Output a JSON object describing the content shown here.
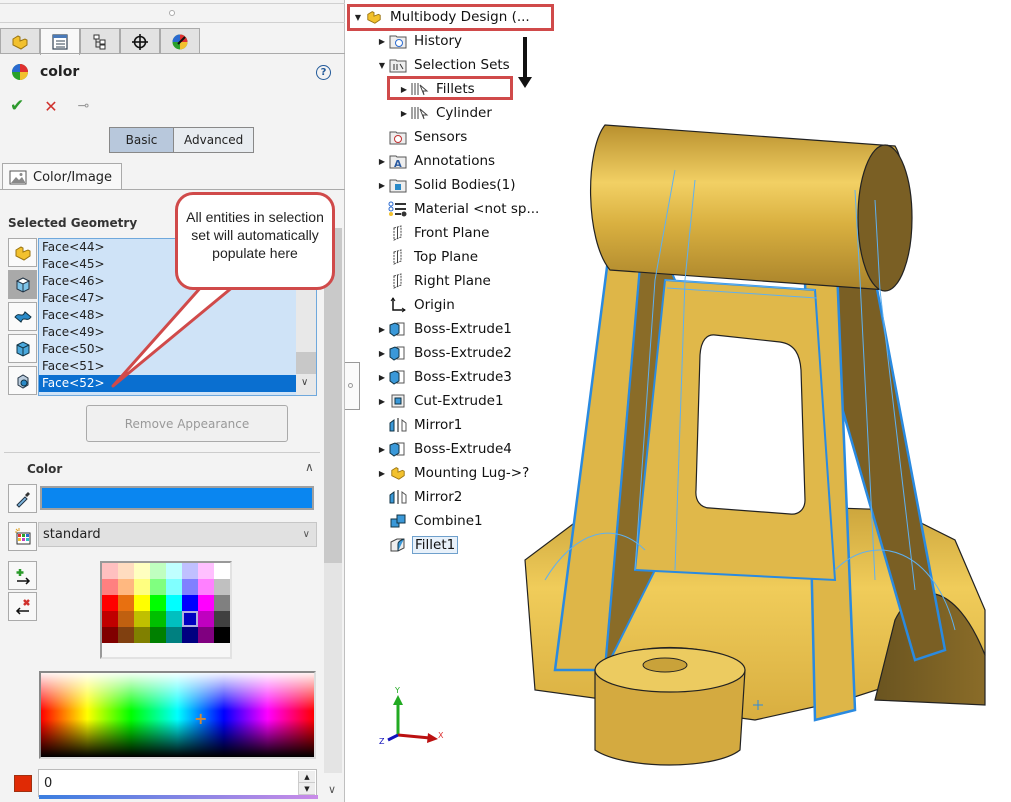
{
  "property_manager": {
    "manager_tabs": [
      {
        "icon": "feature-manager-icon",
        "active": false
      },
      {
        "icon": "property-manager-icon",
        "active": true
      },
      {
        "icon": "configuration-manager-icon",
        "active": false
      },
      {
        "icon": "dimxpert-manager-icon",
        "active": false
      },
      {
        "icon": "display-manager-icon",
        "active": false
      }
    ],
    "title": "color",
    "help_label": "?",
    "ok_label": "✔",
    "cancel_label": "✕",
    "pin_label": "⊸",
    "modes": {
      "basic": "Basic",
      "advanced": "Advanced",
      "active": "Basic"
    },
    "sub_tab": "Color/Image",
    "selected_geometry": {
      "heading": "Selected Geometry",
      "items": [
        "Face<44>",
        "Face<45>",
        "Face<46>",
        "Face<47>",
        "Face<48>",
        "Face<49>",
        "Face<50>",
        "Face<51>",
        "Face<52>"
      ],
      "selected": "Face<52>",
      "filters": [
        "part-filter-icon",
        "face-filter-icon",
        "surface-filter-icon",
        "body-filter-icon",
        "feature-filter-icon"
      ]
    },
    "remove_appearance_label": "Remove Appearance",
    "color_section": {
      "heading": "Color",
      "current_color": "#0a86f0",
      "palette_name": "standard",
      "palette": [
        [
          "#ffc0c0",
          "#ffdcc0",
          "#ffffc0",
          "#c0ffc0",
          "#c0ffff",
          "#c0c0ff",
          "#ffc0ff",
          "#ffffff"
        ],
        [
          "#ff8080",
          "#ffb880",
          "#ffff80",
          "#80ff80",
          "#80ffff",
          "#8080ff",
          "#ff80ff",
          "#c0c0c0"
        ],
        [
          "#ff0000",
          "#e87010",
          "#ffff00",
          "#00ff00",
          "#00ffff",
          "#0000ff",
          "#ff00ff",
          "#808080"
        ],
        [
          "#c00000",
          "#c06010",
          "#c0c000",
          "#00c000",
          "#00c0c0",
          "#0000c0",
          "#c000c0",
          "#404040"
        ],
        [
          "#800000",
          "#804010",
          "#808000",
          "#008000",
          "#008080",
          "#000080",
          "#800080",
          "#000000"
        ]
      ],
      "palette_selected": {
        "row": 3,
        "col": 5
      },
      "rgb_swatch": "#e02a05",
      "value_field": "0"
    }
  },
  "callout": {
    "text": "All entities in selection set will automatically populate here"
  },
  "feature_tree": {
    "items": [
      {
        "label": "Multibody Design  (...",
        "icon": "part-icon",
        "arrow": "expanded",
        "level": 0,
        "highlight": true
      },
      {
        "label": "History",
        "icon": "history-folder-icon",
        "arrow": "collapsed",
        "level": 1
      },
      {
        "label": "Selection Sets",
        "icon": "selection-sets-folder-icon",
        "arrow": "expanded",
        "level": 1
      },
      {
        "label": "Fillets",
        "icon": "selection-set-icon",
        "arrow": "collapsed",
        "level": 2,
        "highlight": true
      },
      {
        "label": "Cylinder",
        "icon": "selection-set-icon",
        "arrow": "collapsed",
        "level": 2
      },
      {
        "label": "Sensors",
        "icon": "sensors-folder-icon",
        "arrow": "none",
        "level": 1
      },
      {
        "label": "Annotations",
        "icon": "annotations-folder-icon",
        "arrow": "collapsed",
        "level": 1
      },
      {
        "label": "Solid Bodies(1)",
        "icon": "solid-bodies-folder-icon",
        "arrow": "collapsed",
        "level": 1
      },
      {
        "label": "Material <not sp...",
        "icon": "material-icon",
        "arrow": "none",
        "level": 1
      },
      {
        "label": "Front Plane",
        "icon": "plane-icon",
        "arrow": "none",
        "level": 1
      },
      {
        "label": "Top Plane",
        "icon": "plane-icon",
        "arrow": "none",
        "level": 1
      },
      {
        "label": "Right Plane",
        "icon": "plane-icon",
        "arrow": "none",
        "level": 1
      },
      {
        "label": "Origin",
        "icon": "origin-icon",
        "arrow": "none",
        "level": 1
      },
      {
        "label": "Boss-Extrude1",
        "icon": "boss-extrude-icon",
        "arrow": "collapsed",
        "level": 1
      },
      {
        "label": "Boss-Extrude2",
        "icon": "boss-extrude-icon",
        "arrow": "collapsed",
        "level": 1
      },
      {
        "label": "Boss-Extrude3",
        "icon": "boss-extrude-icon",
        "arrow": "collapsed",
        "level": 1
      },
      {
        "label": "Cut-Extrude1",
        "icon": "cut-extrude-icon",
        "arrow": "collapsed",
        "level": 1
      },
      {
        "label": "Mirror1",
        "icon": "mirror-icon",
        "arrow": "none",
        "level": 1
      },
      {
        "label": "Boss-Extrude4",
        "icon": "boss-extrude-icon",
        "arrow": "collapsed",
        "level": 1
      },
      {
        "label": "Mounting Lug->?",
        "icon": "part-icon",
        "arrow": "collapsed",
        "level": 1
      },
      {
        "label": "Mirror2",
        "icon": "mirror-icon",
        "arrow": "none",
        "level": 1
      },
      {
        "label": "Combine1",
        "icon": "combine-icon",
        "arrow": "none",
        "level": 1
      },
      {
        "label": "Fillet1",
        "icon": "fillet-icon",
        "arrow": "none",
        "level": 1,
        "selected": true
      }
    ]
  },
  "triad": {
    "x_label": "X",
    "y_label": "Y",
    "z_label": "Z"
  },
  "colors": {
    "accent_red": "#d04a4a",
    "selection_blue": "#0a6fd0",
    "model_gold": "#d9b44a"
  }
}
